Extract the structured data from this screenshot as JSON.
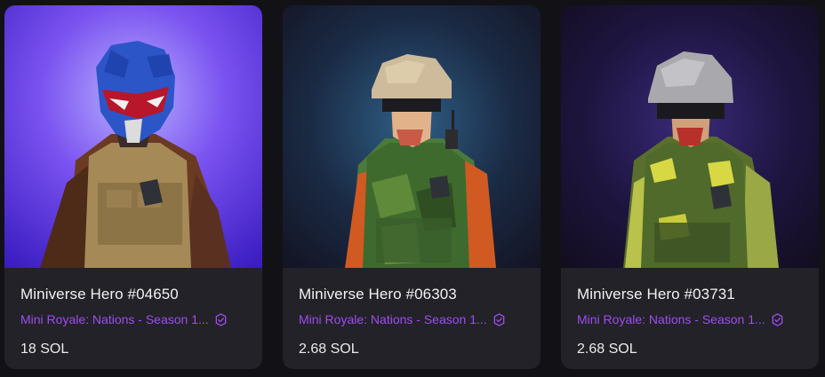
{
  "cards": [
    {
      "title": "Miniverse Hero #04650",
      "collection": "Mini Royale: Nations - Season 1...",
      "price": "18 SOL",
      "verified_icon": "verified-badge-icon",
      "accent": "#a04cf0"
    },
    {
      "title": "Miniverse Hero #06303",
      "collection": "Mini Royale: Nations - Season 1...",
      "price": "2.68 SOL",
      "verified_icon": "verified-badge-icon",
      "accent": "#a04cf0"
    },
    {
      "title": "Miniverse Hero #03731",
      "collection": "Mini Royale: Nations - Season 1...",
      "price": "2.68 SOL",
      "verified_icon": "verified-badge-icon",
      "accent": "#a04cf0"
    }
  ]
}
